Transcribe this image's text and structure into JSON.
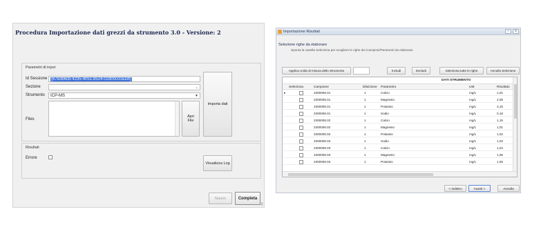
{
  "left_window": {
    "title": "Procedura Importazione dati grezzi da strumento 3.0 - Versione: 2",
    "params_group": "Parametri di input",
    "id_sessione_label": "Id Sessione",
    "id_sessione_value": "{67e3b6cb-4235-4051-8524-02d00cc0a18f}",
    "sezione_label": "Sezione",
    "sezione_value": "",
    "strumento_label": "Strumento",
    "strumento_value": "ICP-MS",
    "file_label": "Files",
    "apri_file_button": "Apri\nFile",
    "importa_dati_button": "Importa dati",
    "results_group": "Risultati",
    "errore_label": "Errore",
    "visualizza_log_button": "Visualizza Log",
    "nuovo_button": "Nuovo",
    "completa_button": "Completa"
  },
  "right_window": {
    "title": "Importazione Risultati",
    "section_title": "Selezione righe da elaborare",
    "section_hint": "Spunta la casella Seleziona per scegliere le righe dei Campioni/Parametri da elaborare",
    "toolbar": {
      "apply_units": "Applica Unità di misura dello Strumento",
      "units_value": "",
      "includi": "Includi",
      "escludi": "Escludi",
      "select_all": "Seleziona tutte le righe",
      "cancel_selection": "Annulla Selezione"
    },
    "grid_group_header": "DATI STRUMENTO",
    "columns": [
      "Seleziona",
      "Campione",
      "Diluizione",
      "Parametro",
      "UM",
      "Risultato"
    ],
    "rows": [
      [
        "",
        "2300006.01",
        "1",
        "Calcio",
        "mg/L",
        "1,01"
      ],
      [
        "",
        "2300006.01",
        "1",
        "Magnesio",
        "mg/L",
        "2,05"
      ],
      [
        "",
        "2300006.01",
        "1",
        "Potassio",
        "mg/L",
        "3,15"
      ],
      [
        "",
        "2300006.01",
        "1",
        "Sodio",
        "mg/L",
        "0,18"
      ],
      [
        "",
        "2300006.02",
        "1",
        "Calcio",
        "mg/L",
        "1,15"
      ],
      [
        "",
        "2300006.02",
        "1",
        "Magnesio",
        "mg/L",
        "1,01"
      ],
      [
        "",
        "2300006.02",
        "1",
        "Potassio",
        "mg/L",
        "1,02"
      ],
      [
        "",
        "2300006.02",
        "1",
        "Sodio",
        "mg/L",
        "1,03"
      ],
      [
        "",
        "2300006.03",
        "1",
        "Calcio",
        "mg/L",
        "1,04"
      ],
      [
        "",
        "2300006.03",
        "1",
        "Magnesio",
        "mg/L",
        "1,05"
      ],
      [
        "",
        "2300006.03",
        "1",
        "Potassio",
        "mg/L",
        "1,06"
      ]
    ],
    "nav": {
      "back": "< Indietro",
      "next": "Avanti >",
      "cancel": "Annulla"
    }
  },
  "colors": {
    "accent": "#3a6fd8",
    "title_text": "#1d2a52"
  }
}
